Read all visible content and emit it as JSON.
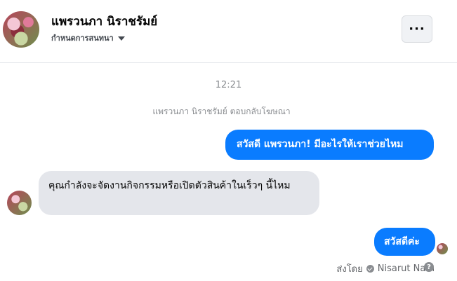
{
  "header": {
    "contact_name": "แพรวนภา นิราชรัมย์",
    "assign_label": "กำหนดการสนทนา",
    "more_label": "···"
  },
  "conversation": {
    "timestamp": "12:21",
    "notice": "แพรวนภา นิราชรัมย์ ตอบกลับโฆษณา",
    "messages": [
      {
        "direction": "outgoing",
        "text": "สวัสดี แพรวนภา! มีอะไรให้เราช่วยไหม"
      },
      {
        "direction": "incoming",
        "text": "คุณกำลังจะจัดงานกิจกรรมหรือเปิดตัวสินค้าในเร็วๆ นี้ไหม"
      },
      {
        "direction": "outgoing",
        "text": "สวัสดีค่ะ"
      }
    ],
    "sent_by_label": "ส่งโดย",
    "sender_name": "Nisarut Nam",
    "help_glyph": "?"
  },
  "colors": {
    "outgoing_bubble": "#0a7cff",
    "incoming_bubble": "#e4e6eb",
    "muted_text": "#8a8d91"
  }
}
